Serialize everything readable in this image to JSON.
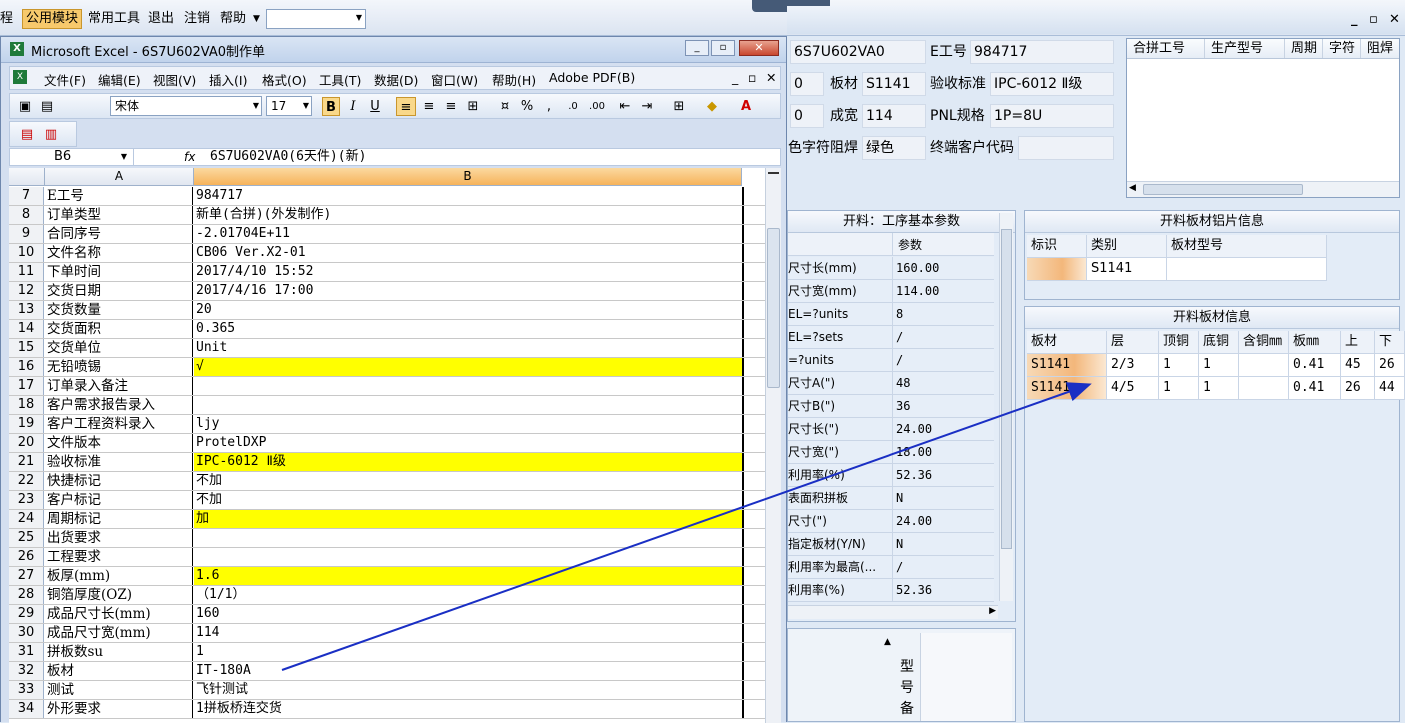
{
  "topmenu": {
    "items": [
      "程",
      "公用模块",
      "常用工具",
      "退出",
      "注销",
      "帮助"
    ],
    "active_index": 1
  },
  "excel": {
    "title": "Microsoft Excel - 6S7U602VA0制作单",
    "menu": [
      "文件(F)",
      "编辑(E)",
      "视图(V)",
      "插入(I)",
      "格式(O)",
      "工具(T)",
      "数据(D)",
      "窗口(W)",
      "帮助(H)",
      "Adobe PDF(B)"
    ],
    "font": "宋体",
    "size": "17",
    "cell_ref": "B6",
    "fx": "fx",
    "formula": "6S7U602VA0(6天件)(新)",
    "col_a": "A",
    "col_b": "B",
    "rows": [
      {
        "n": "7",
        "a": "E工号",
        "b": "984717",
        "y": false
      },
      {
        "n": "8",
        "a": "订单类型",
        "b": "新单(合拼)(外发制作)",
        "y": false
      },
      {
        "n": "9",
        "a": "合同序号",
        "b": "-2.01704E+11",
        "y": false
      },
      {
        "n": "10",
        "a": "文件名称",
        "b": "CB06 Ver.X2-01",
        "y": false
      },
      {
        "n": "11",
        "a": "下单时间",
        "b": "2017/4/10 15:52",
        "y": false
      },
      {
        "n": "12",
        "a": "交货日期",
        "b": "2017/4/16 17:00",
        "y": false
      },
      {
        "n": "13",
        "a": "交货数量",
        "b": "20",
        "y": false
      },
      {
        "n": "14",
        "a": "交货面积",
        "b": "0.365",
        "y": false
      },
      {
        "n": "15",
        "a": "交货单位",
        "b": "Unit",
        "y": false
      },
      {
        "n": "16",
        "a": "无铅喷锡",
        "b": "√",
        "y": true
      },
      {
        "n": "17",
        "a": "订单录入备注",
        "b": "",
        "y": false
      },
      {
        "n": "18",
        "a": "客户需求报告录入",
        "b": "",
        "y": false
      },
      {
        "n": "19",
        "a": "客户工程资料录入",
        "b": "ljy",
        "y": false
      },
      {
        "n": "20",
        "a": "文件版本",
        "b": "ProtelDXP",
        "y": false
      },
      {
        "n": "21",
        "a": "验收标准",
        "b": "IPC-6012 Ⅱ级",
        "y": true
      },
      {
        "n": "22",
        "a": "快捷标记",
        "b": "不加",
        "y": false
      },
      {
        "n": "23",
        "a": "客户标记",
        "b": "不加",
        "y": false
      },
      {
        "n": "24",
        "a": "周期标记",
        "b": "加",
        "y": true
      },
      {
        "n": "25",
        "a": "出货要求",
        "b": "",
        "y": false
      },
      {
        "n": "26",
        "a": "工程要求",
        "b": "",
        "y": false
      },
      {
        "n": "27",
        "a": "板厚(mm)",
        "b": "1.6",
        "y": true
      },
      {
        "n": "28",
        "a": "铜箔厚度(OZ)",
        "b": "（1/1）",
        "y": false
      },
      {
        "n": "29",
        "a": "成品尺寸长(mm)",
        "b": "160",
        "y": false
      },
      {
        "n": "30",
        "a": "成品尺寸宽(mm)",
        "b": "114",
        "y": false
      },
      {
        "n": "31",
        "a": "拼板数su",
        "b": "1",
        "y": false
      },
      {
        "n": "32",
        "a": "板材",
        "b": "IT-180A",
        "y": false
      },
      {
        "n": "33",
        "a": "测试",
        "b": "飞针测试",
        "y": false
      },
      {
        "n": "34",
        "a": "外形要求",
        "b": "1拼板桥连交货",
        "y": false
      }
    ]
  },
  "form": {
    "job_value": "6S7U602VA0",
    "ejob_label": "E工号",
    "ejob_value": "984717",
    "f1": "0",
    "plate_label": "板材",
    "plate_value": "S1141",
    "std_label": "验收标准",
    "std_value": "IPC-6012 Ⅱ级",
    "f2": "0",
    "width_label": "成宽",
    "width_value": "114",
    "pnl_label": "PNL规格",
    "pnl_value": "1P=8U",
    "silk_label": "色字符",
    "mask_label": "阻焊",
    "mask_value": "绿色",
    "endcust_label": "终端客户代码",
    "endcust_value": ""
  },
  "grid1": {
    "headers": [
      "合拼工号",
      "生产型号",
      "周期",
      "字符",
      "阻焊"
    ]
  },
  "params": {
    "title": "开料：工序基本参数",
    "value_header": "参数",
    "rows": [
      {
        "k": "尺寸长(mm)",
        "v": "160.00"
      },
      {
        "k": "尺寸宽(mm)",
        "v": "114.00"
      },
      {
        "k": "EL=?units",
        "v": "8"
      },
      {
        "k": "EL=?sets",
        "v": "/"
      },
      {
        "k": "=?units",
        "v": "/"
      },
      {
        "k": "尺寸A(\")",
        "v": "48"
      },
      {
        "k": "尺寸B(\")",
        "v": "36"
      },
      {
        "k": "尺寸长(\")",
        "v": "24.00"
      },
      {
        "k": "尺寸宽(\")",
        "v": "18.00"
      },
      {
        "k": "利用率(%)",
        "v": "52.36"
      },
      {
        "k": "表面积拼板",
        "v": "N"
      },
      {
        "k": "尺寸(\")",
        "v": "24.00"
      },
      {
        "k": "指定板材(Y/N)",
        "v": "N"
      },
      {
        "k": "利用率为最高(...",
        "v": "/"
      },
      {
        "k": "利用率(%)",
        "v": "52.36"
      }
    ]
  },
  "alu": {
    "title": "开料板材铝片信息",
    "headers": [
      "标识",
      "类别",
      "板材型号"
    ],
    "row": [
      "",
      "S1141",
      ""
    ]
  },
  "boards": {
    "title": "开料板材信息",
    "headers": [
      "板材",
      "层",
      "顶铜",
      "底铜",
      "含铜㎜",
      "板㎜",
      "上",
      "下"
    ],
    "rows": [
      [
        "S1141",
        "2/3",
        "1",
        "1",
        "",
        "0.41",
        "45",
        "26"
      ],
      [
        "S1141",
        "4/5",
        "1",
        "1",
        "",
        "0.41",
        "26",
        "44"
      ]
    ]
  },
  "bottom": {
    "vertical_label": "型号备"
  },
  "colors": {
    "yellow": "#ffff00",
    "arrow": "#1a2fc4",
    "orange": "#f3b77b"
  }
}
